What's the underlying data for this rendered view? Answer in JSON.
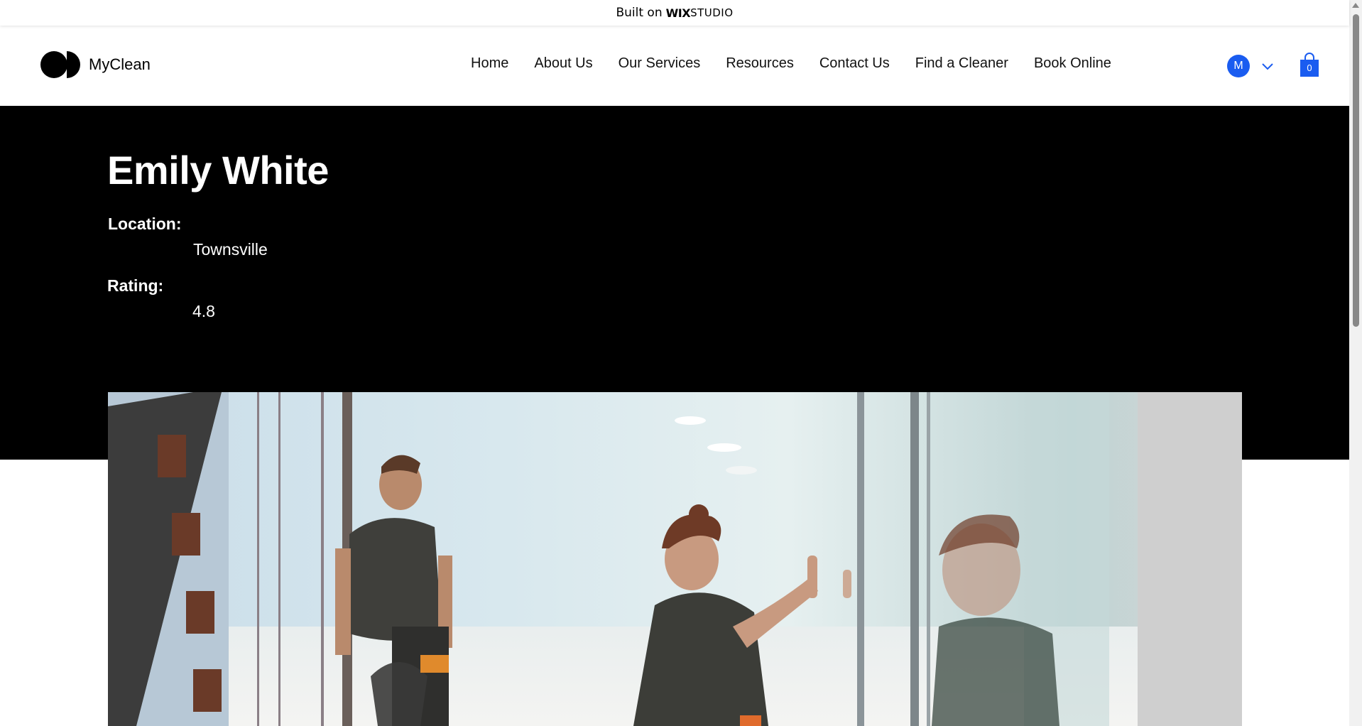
{
  "banner": {
    "built_on": "Built on",
    "brand": "WIX",
    "product": "STUDIO"
  },
  "header": {
    "logo_text": "MyClean",
    "nav": [
      "Home",
      "About Us",
      "Our Services",
      "Resources",
      "Contact Us",
      "Find a Cleaner",
      "Book Online"
    ],
    "user_initial": "M",
    "cart_count": "0"
  },
  "profile": {
    "name": "Emily White",
    "location_label": "Location:",
    "location": "Townsville",
    "rating_label": "Rating:",
    "rating": "4.8"
  },
  "colors": {
    "accent": "#1a5cf0",
    "hero_bg": "#000000"
  }
}
